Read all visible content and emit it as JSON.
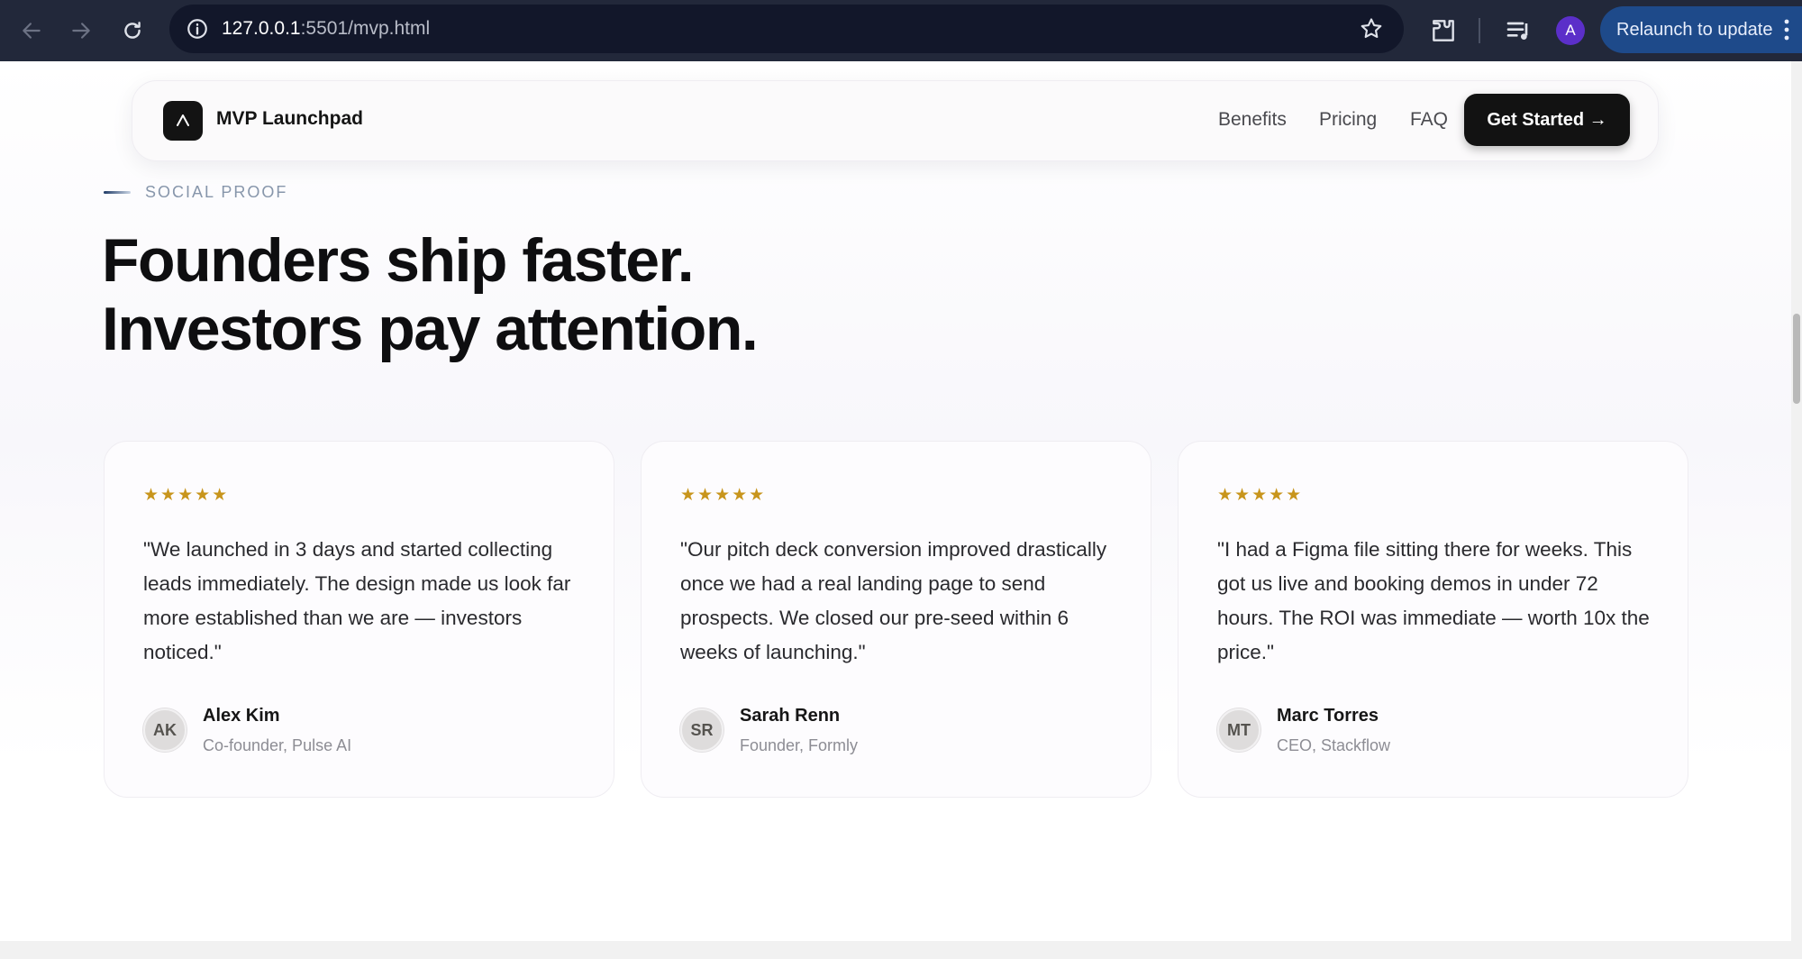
{
  "browser": {
    "url_host": "127.0.0.1",
    "url_path": ":5501/mvp.html",
    "profile_initial": "A",
    "relaunch_label": "Relaunch to update",
    "icons": [
      "back-arrow-icon",
      "forward-arrow-icon",
      "reload-icon",
      "info-icon",
      "star-icon",
      "extensions-icon",
      "media-control-icon",
      "more-menu-icon"
    ]
  },
  "site_nav": {
    "brand": "MVP Launchpad",
    "logo_icon": "launch-triangle-icon",
    "links": [
      "Benefits",
      "Pricing",
      "FAQ"
    ],
    "cta": "Get Started →"
  },
  "section": {
    "eyebrow": "SOCIAL PROOF",
    "headline_line1": "Founders ship faster.",
    "headline_line2": "Investors pay attention."
  },
  "testimonials": [
    {
      "stars": "★★★★★",
      "rating": 5,
      "quote": "\"We launched in 3 days and started collecting leads immediately. The design made us look far more established than we are — investors noticed.\"",
      "initials": "AK",
      "name": "Alex Kim",
      "role": "Co-founder, Pulse AI"
    },
    {
      "stars": "★★★★★",
      "rating": 5,
      "quote": "\"Our pitch deck conversion improved drastically once we had a real landing page to send prospects. We closed our pre-seed within 6 weeks of launching.\"",
      "initials": "SR",
      "name": "Sarah Renn",
      "role": "Founder, Formly"
    },
    {
      "stars": "★★★★★",
      "rating": 5,
      "quote": "\"I had a Figma file sitting there for weeks. This got us live and booking demos in under 72 hours. The ROI was immediate — worth 10x the price.\"",
      "initials": "MT",
      "name": "Marc Torres",
      "role": "CEO, Stackflow"
    }
  ],
  "colors": {
    "chrome_bg": "#22283a",
    "accent_star": "#c8951c",
    "cta_bg": "#121212",
    "relaunch_bg": "#1e4a8a"
  }
}
